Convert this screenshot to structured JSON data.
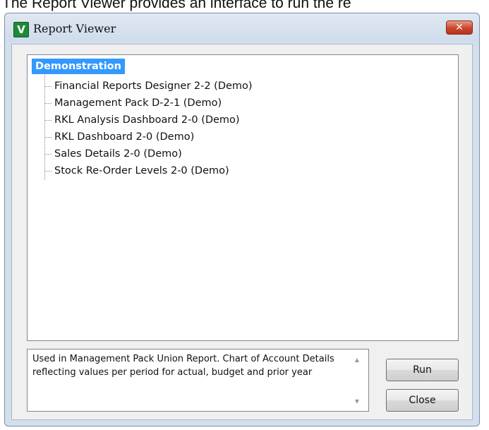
{
  "caption": "The Report Viewer provides an interface to run the re",
  "window": {
    "title": "Report Viewer",
    "app_icon_letter": "V",
    "close_glyph": "✕"
  },
  "tree": {
    "root_label": "Demonstration",
    "items": [
      "Financial Reports Designer 2-2 (Demo)",
      "Management Pack D-2-1 (Demo)",
      "RKL Analysis Dashboard 2-0 (Demo)",
      "RKL Dashboard 2-0 (Demo)",
      "Sales Details 2-0 (Demo)",
      "Stock Re-Order Levels 2-0 (Demo)"
    ]
  },
  "description": {
    "text": "Used in Management Pack Union Report. Chart of Account Details reflecting values per period for actual, budget and prior year"
  },
  "buttons": {
    "run": "Run",
    "close": "Close"
  },
  "colors": {
    "selection": "#3399ff",
    "close_button": "#c9452a",
    "app_icon": "#1f8a3a"
  }
}
